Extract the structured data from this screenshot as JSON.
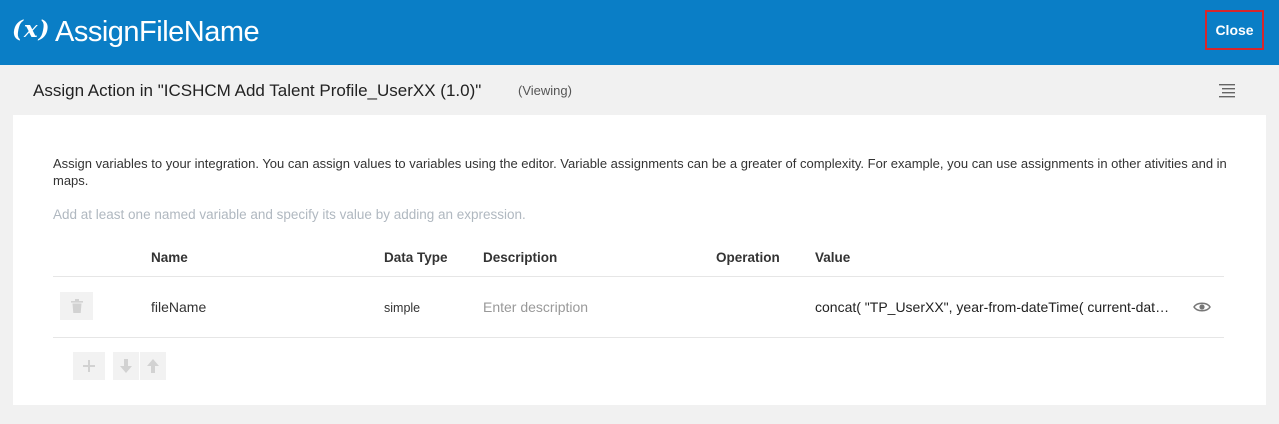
{
  "header": {
    "icon_text": "(x)",
    "title": "AssignFileName",
    "close_label": "Close",
    "color": "#0a7ec6"
  },
  "subheader": {
    "title": "Assign Action in \"ICSHCM Add Talent Profile_UserXX (1.0)\"",
    "mode": "(Viewing)",
    "menu_icon": "menu-lines-icon"
  },
  "main": {
    "description": "Assign variables to your integration. You can assign values to variables using the editor. Variable assignments can be a greater of complexity. For example, you can use assignments in other ativities and in maps.",
    "hint": "Add at least one named variable and specify its value by adding an expression.",
    "columns": [
      "Name",
      "Data Type",
      "Description",
      "Operation",
      "Value"
    ],
    "rows": [
      {
        "name": "fileName",
        "data_type": "simple",
        "description_placeholder": "Enter description",
        "operation": "",
        "value": "concat( \"TP_UserXX\", year-from-dateTime( current-dateTime() ) )"
      }
    ],
    "toolbar_icons": [
      "add-icon",
      "move-down-icon",
      "move-up-icon"
    ]
  }
}
